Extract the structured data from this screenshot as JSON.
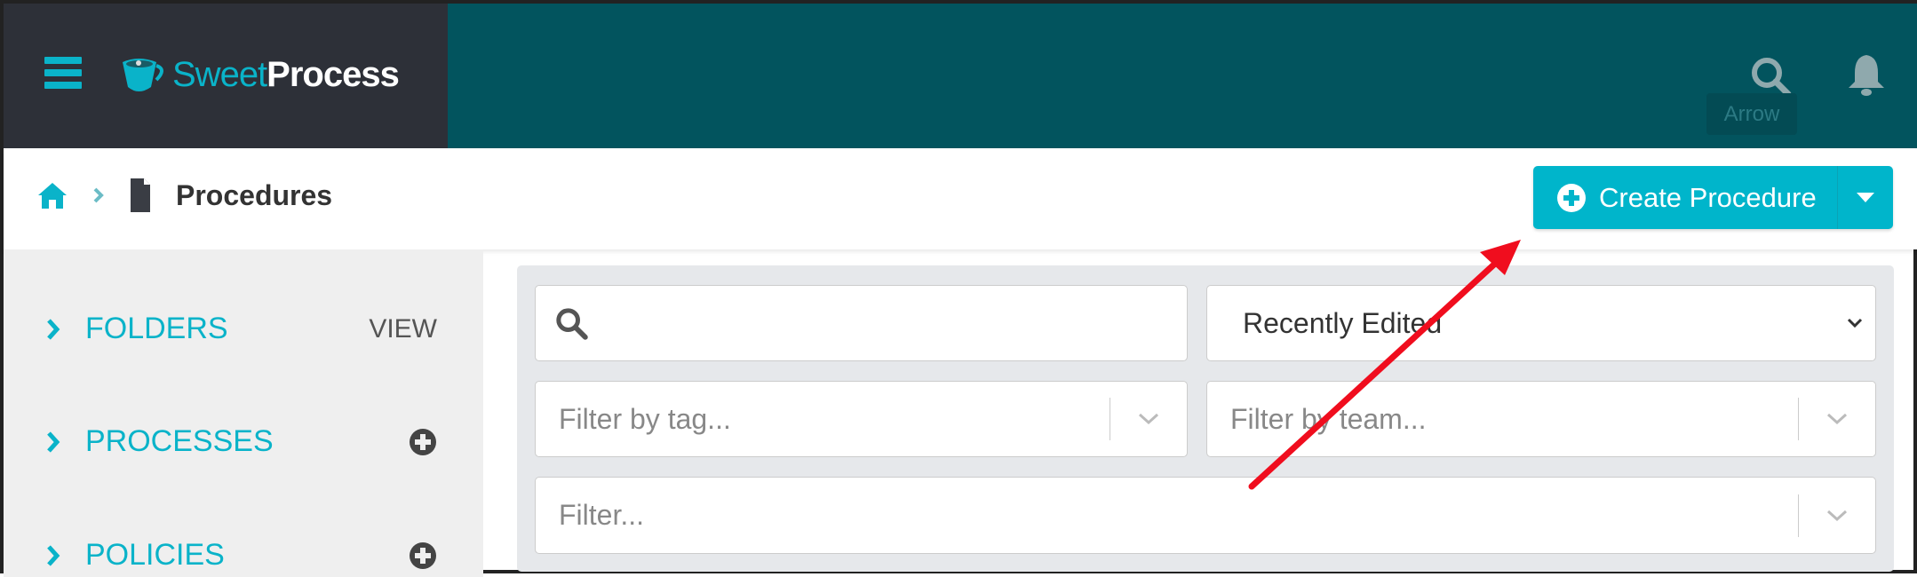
{
  "header": {
    "brand_part1": "Sweet",
    "brand_part2": "Process",
    "tooltip": "Arrow",
    "icons": [
      "menu-icon",
      "search-icon",
      "bell-icon"
    ]
  },
  "breadcrumb": {
    "title": "Procedures",
    "icons": [
      "home-icon",
      "chevron-right-icon",
      "document-icon"
    ]
  },
  "create_button": {
    "label": "Create Procedure"
  },
  "sidebar": {
    "items": [
      {
        "label": "FOLDERS",
        "action": "VIEW"
      },
      {
        "label": "PROCESSES",
        "action": "plus-circle-icon"
      },
      {
        "label": "POLICIES",
        "action": "plus-circle-icon"
      }
    ]
  },
  "filters": {
    "search_value": "",
    "sort_value": "Recently Edited",
    "tag_placeholder": "Filter by tag...",
    "team_placeholder": "Filter by team...",
    "filter_placeholder": "Filter..."
  },
  "colors": {
    "accent": "#00b5cb",
    "topbar": "#02545e",
    "brand_bg": "#2d3038",
    "annotation": "#ff0000"
  }
}
